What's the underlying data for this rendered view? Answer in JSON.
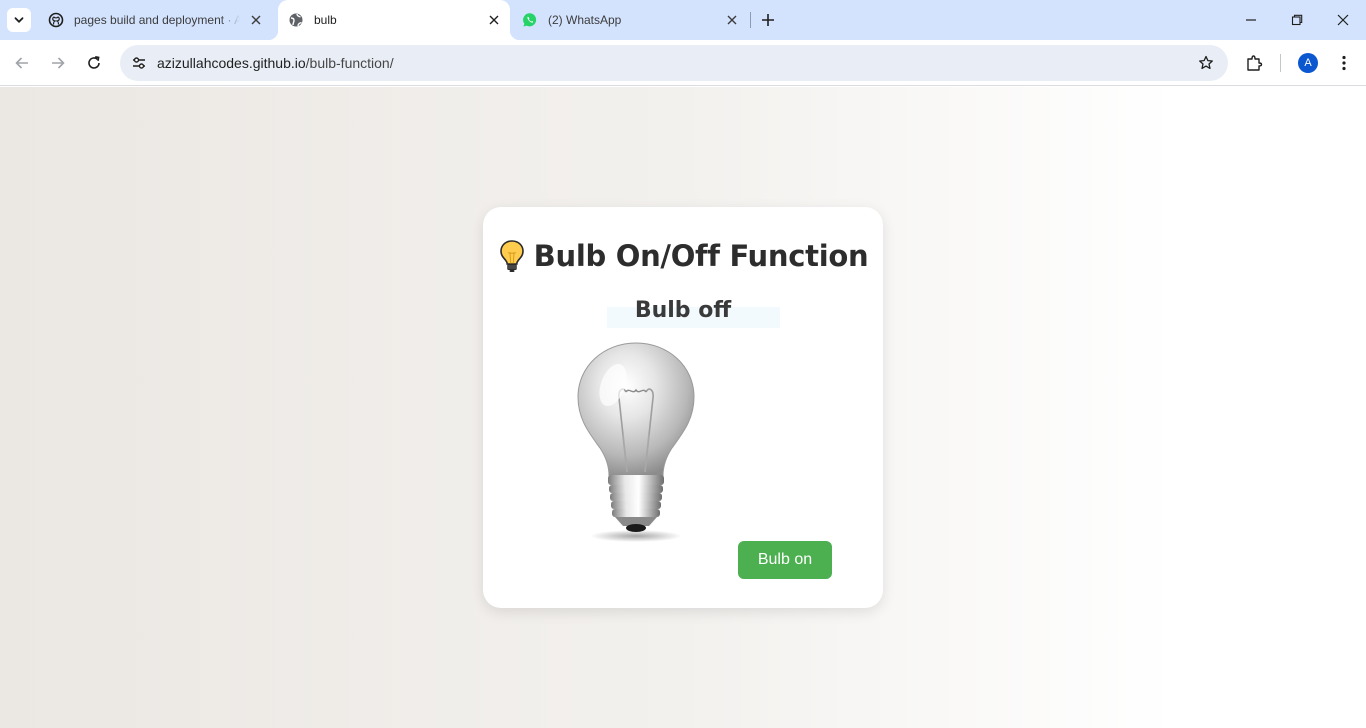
{
  "browser": {
    "tabs": [
      {
        "title": "pages build and deployment · A",
        "favicon": "github-icon",
        "active": false
      },
      {
        "title": "bulb",
        "favicon": "globe-icon",
        "active": true
      },
      {
        "title": "(2) WhatsApp",
        "favicon": "whatsapp-icon",
        "active": false
      }
    ],
    "address": {
      "domain": "azizullahcodes.github.io",
      "path": "/bulb-function/"
    },
    "profile_initial": "A",
    "accent_color": "#0b57d0"
  },
  "page": {
    "heading_icon": "lightbulb-icon",
    "heading": "Bulb On/Off Function",
    "status": "Bulb off",
    "bulb_state": "off",
    "button_label": "Bulb on",
    "button_color": "#4caf50"
  }
}
